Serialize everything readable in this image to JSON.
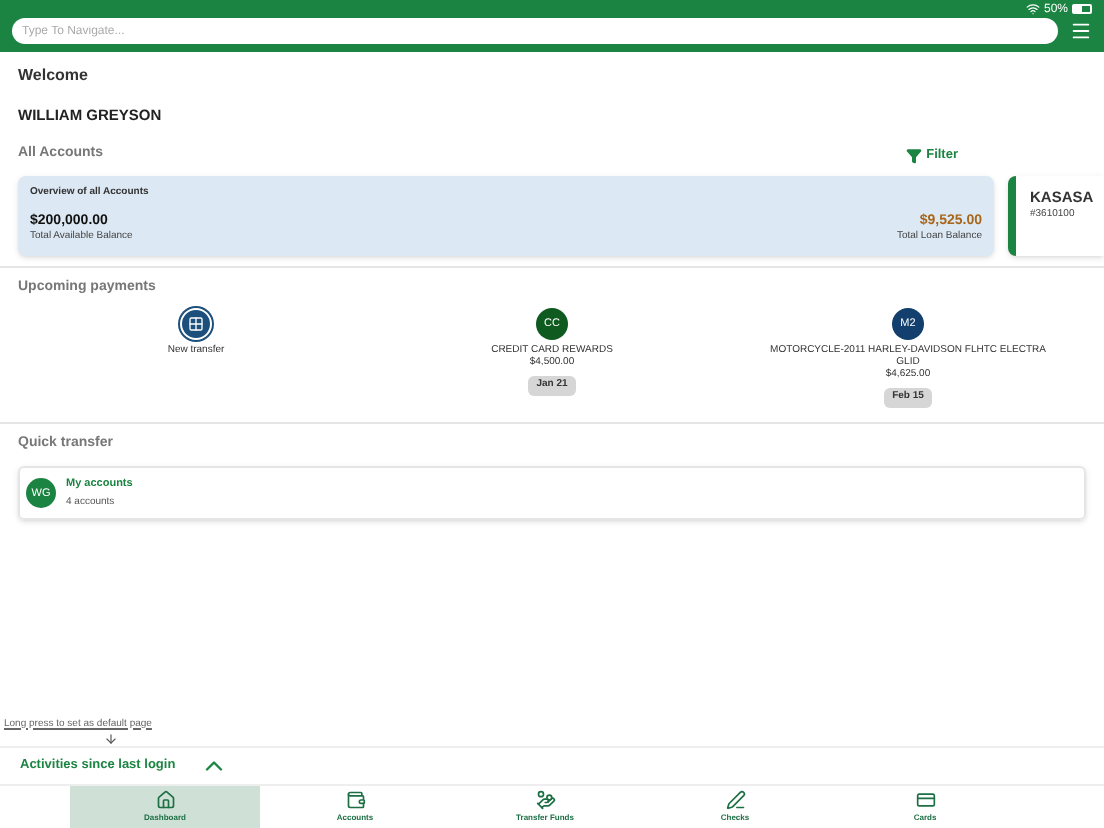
{
  "status_bar": {
    "battery": "50%"
  },
  "search": {
    "placeholder": "Type To Navigate..."
  },
  "welcome": "Welcome",
  "user_name": "WILLIAM GREYSON",
  "accounts": {
    "title": "All Accounts",
    "filter": "Filter",
    "overview": {
      "title": "Overview of all Accounts",
      "available": "$200,000.00",
      "available_label": "Total Available Balance",
      "loan": "$9,525.00",
      "loan_label": "Total Loan Balance"
    },
    "account_card": {
      "name": "KASASA",
      "number": "#3610100"
    }
  },
  "upcoming": {
    "title": "Upcoming payments",
    "items": [
      {
        "kind": "new",
        "label": "New transfer"
      },
      {
        "kind": "payment",
        "initials": "CC",
        "color": "#0f5a1f",
        "name": "CREDIT CARD REWARDS",
        "amount": "$4,500.00",
        "date": "Jan 21"
      },
      {
        "kind": "payment",
        "initials": "M2",
        "color": "#123f6e",
        "name": "MOTORCYCLE-2011 HARLEY-DAVIDSON FLHTC ELECTRA GLID",
        "amount": "$4,625.00",
        "date": "Feb 15"
      }
    ]
  },
  "quick_transfer": {
    "title": "Quick transfer",
    "initials": "WG",
    "name": "My accounts",
    "count": "4 accounts"
  },
  "hint": "Long press to set as default page",
  "activities": {
    "title": "Activities since last login",
    "expanded": true
  },
  "nav": [
    {
      "kind": "dashboard",
      "label": "Dashboard",
      "selected": true
    },
    {
      "kind": "accounts",
      "label": "Accounts",
      "selected": false
    },
    {
      "kind": "transfer",
      "label": "Transfer Funds",
      "selected": false
    },
    {
      "kind": "checks",
      "label": "Checks",
      "selected": false
    },
    {
      "kind": "cards",
      "label": "Cards",
      "selected": false
    }
  ]
}
